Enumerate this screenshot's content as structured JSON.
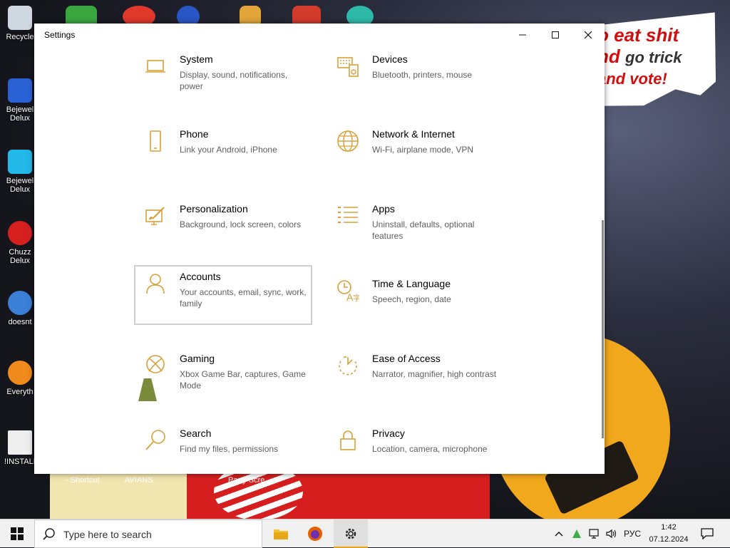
{
  "window": {
    "title": "Settings"
  },
  "settings_tiles": [
    {
      "title": "System",
      "description": "Display, sound, notifications, power",
      "icon": "laptop-icon"
    },
    {
      "title": "Devices",
      "description": "Bluetooth, printers, mouse",
      "icon": "keyboard-speaker-icon"
    },
    {
      "title": "Phone",
      "description": "Link your Android, iPhone",
      "icon": "phone-icon"
    },
    {
      "title": "Network & Internet",
      "description": "Wi-Fi, airplane mode, VPN",
      "icon": "globe-icon"
    },
    {
      "title": "Personalization",
      "description": "Background, lock screen, colors",
      "icon": "brush-screen-icon"
    },
    {
      "title": "Apps",
      "description": "Uninstall, defaults, optional features",
      "icon": "apps-list-icon"
    },
    {
      "title": "Accounts",
      "description": "Your accounts, email, sync, work, family",
      "icon": "person-icon"
    },
    {
      "title": "Time & Language",
      "description": "Speech, region, date",
      "icon": "clock-language-icon"
    },
    {
      "title": "Gaming",
      "description": "Xbox Game Bar, captures, Game Mode",
      "icon": "xbox-icon"
    },
    {
      "title": "Ease of Access",
      "description": "Narrator, magnifier, high contrast",
      "icon": "ease-of-access-icon"
    },
    {
      "title": "Search",
      "description": "Find my files, permissions",
      "icon": "search-icon"
    },
    {
      "title": "Privacy",
      "description": "Location, camera, microphone",
      "icon": "lock-icon"
    }
  ],
  "selected_tile": "Accounts",
  "accent_color": "#d9a03a",
  "desktop_icons": [
    "Recycle",
    "Bejewel Delux",
    "Bejewel Delux",
    "Chuzz Delux",
    "doesnt",
    "Everyth",
    "!INSTALL"
  ],
  "wallpaper_text": {
    "line1": "o eat shit",
    "line2a": "nd",
    "line2b": "go trick",
    "line3": "and vote!",
    "labels": [
      "- Shortcut",
      "AVIANS",
      "Party Scre..."
    ]
  },
  "taskbar": {
    "search_placeholder": "Type here to search",
    "language": "РУС",
    "time": "1:42",
    "date": "07.12.2024",
    "active_app": "Settings"
  }
}
